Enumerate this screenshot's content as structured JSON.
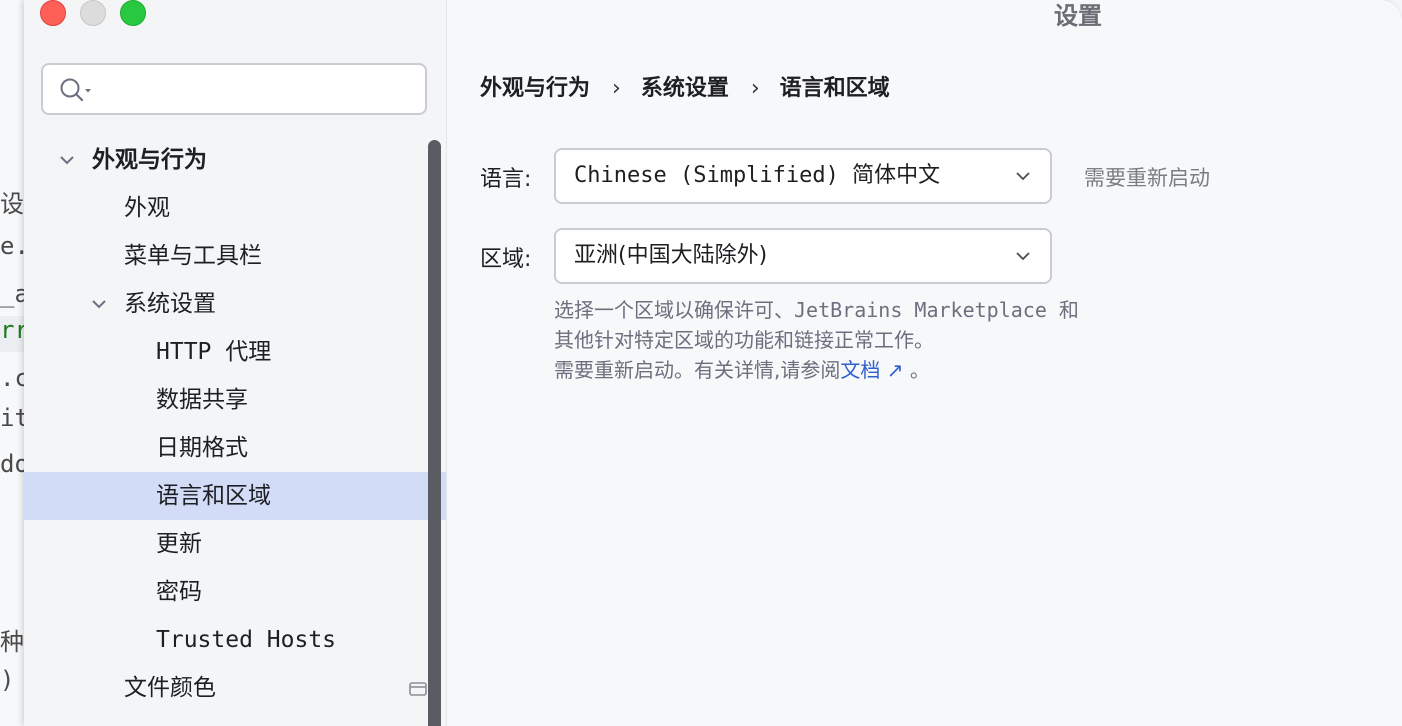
{
  "dialog": {
    "title": "设置"
  },
  "background_editor": {
    "lines": [
      "设置",
      "e.",
      "_a",
      "rr",
      ".c",
      "it",
      "do",
      "种",
      ")"
    ]
  },
  "search": {
    "placeholder": "",
    "value": ""
  },
  "sidebar": {
    "items": [
      {
        "label": "外观与行为",
        "level": 0,
        "expanded": true,
        "selected": false
      },
      {
        "label": "外观",
        "level": 1,
        "selected": false
      },
      {
        "label": "菜单与工具栏",
        "level": 1,
        "selected": false
      },
      {
        "label": "系统设置",
        "level": 1,
        "expanded": true,
        "selected": false
      },
      {
        "label": "HTTP 代理",
        "level": 2,
        "selected": false
      },
      {
        "label": "数据共享",
        "level": 2,
        "selected": false
      },
      {
        "label": "日期格式",
        "level": 2,
        "selected": false
      },
      {
        "label": "语言和区域",
        "level": 2,
        "selected": true
      },
      {
        "label": "更新",
        "level": 2,
        "selected": false
      },
      {
        "label": "密码",
        "level": 2,
        "selected": false
      },
      {
        "label": "Trusted Hosts",
        "level": 2,
        "selected": false
      },
      {
        "label": "文件颜色",
        "level": 1,
        "selected": false
      }
    ]
  },
  "breadcrumb": [
    "外观与行为",
    "系统设置",
    "语言和区域"
  ],
  "breadcrumb_separator": "›",
  "language": {
    "label": "语言:",
    "value": "Chinese (Simplified) 简体中文",
    "note": "需要重新启动"
  },
  "region": {
    "label": "区域:",
    "value": "亚洲(中国大陆除外)",
    "help_line1": "选择一个区域以确保许可、JetBrains Marketplace 和",
    "help_line2": "其他针对特定区域的功能和链接正常工作。",
    "help_line3_prefix": "需要重新启动。有关详情,请参阅",
    "help_link": "文档 ↗",
    "help_line3_suffix": " 。"
  },
  "colors": {
    "selection": "#d2dcf7",
    "link": "#2f5fcf",
    "close": "#fe5f57",
    "maximize": "#28c840"
  }
}
